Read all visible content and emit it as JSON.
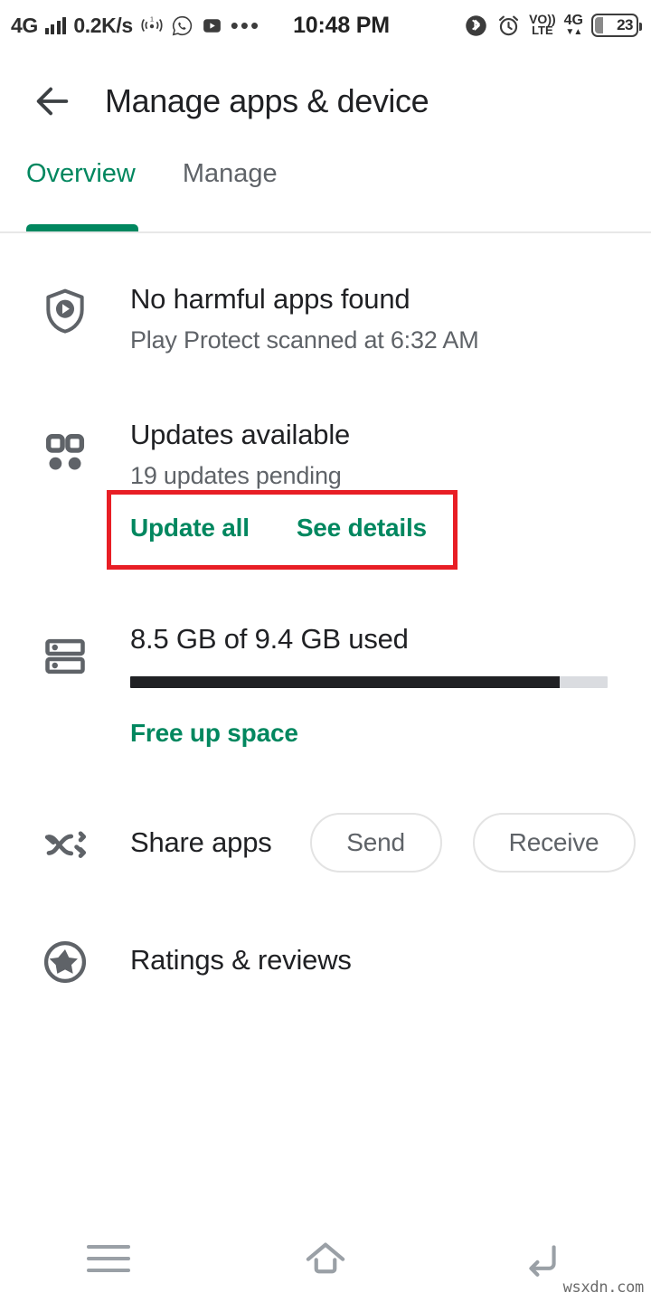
{
  "status_bar": {
    "network_type": "4G",
    "signal_icon": "signal-bars-icon",
    "data_rate": "0.2K/s",
    "hotspot_icon": "hotspot-icon",
    "hotspot_badge": "1",
    "whatsapp_icon": "whatsapp-icon",
    "youtube_icon": "youtube-icon",
    "overflow_icon": "more-dots-icon",
    "clock": "10:48 PM",
    "bluetooth_icon": "bluetooth-icon",
    "alarm_icon": "alarm-clock-icon",
    "volte_top": "VO))",
    "volte_bottom": "LTE",
    "mobile_label": "4G",
    "mobile_arrows": "▼▲",
    "battery_percent": "23",
    "battery_icon": "battery-icon"
  },
  "app_bar": {
    "back_icon": "back-arrow-icon",
    "title": "Manage apps & device"
  },
  "tabs": [
    {
      "label": "Overview",
      "active": true
    },
    {
      "label": "Manage",
      "active": false
    }
  ],
  "sections": {
    "play_protect": {
      "icon": "play-protect-shield-icon",
      "title": "No harmful apps found",
      "subtitle": "Play Protect scanned at 6:32 AM"
    },
    "updates": {
      "icon": "apps-grid-icon",
      "title": "Updates available",
      "subtitle": "19 updates pending",
      "update_all_label": "Update all",
      "see_details_label": "See details"
    },
    "storage": {
      "icon": "storage-icon",
      "title": "8.5 GB of 9.4 GB used",
      "used_gb": 8.5,
      "total_gb": 9.4,
      "used_percent": 90,
      "free_up_label": "Free up space"
    },
    "share": {
      "icon": "share-apps-icon",
      "title": "Share apps",
      "send_label": "Send",
      "receive_label": "Receive"
    },
    "ratings": {
      "icon": "star-circle-icon",
      "title": "Ratings & reviews"
    }
  },
  "nav_bar": {
    "recents_icon": "menu-recents-icon",
    "home_icon": "home-icon",
    "back_icon": "back-nav-icon"
  },
  "watermark": "wsxdn.com",
  "colors": {
    "accent_green": "#01875f",
    "annotation_red": "#e81e25",
    "text_primary": "#202124",
    "text_secondary": "#5f6368"
  }
}
